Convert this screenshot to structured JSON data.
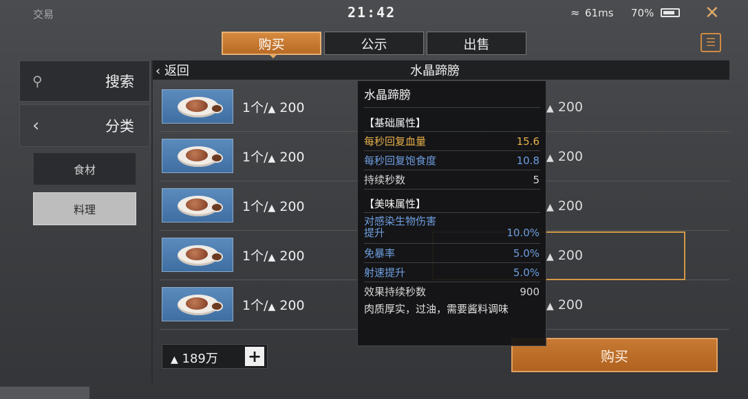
{
  "status_bar": {
    "app_name": "交易",
    "time": "21:42",
    "wifi_icon": "wifi-icon",
    "ping": "61ms",
    "battery": "70%",
    "close_icon": "close-icon"
  },
  "tabs": [
    {
      "label": "购买",
      "active": true
    },
    {
      "label": "公示",
      "active": false
    },
    {
      "label": "出售",
      "active": false
    }
  ],
  "sidebar": {
    "search": {
      "icon": "search-icon",
      "label": "搜索"
    },
    "category": {
      "icon": "chevron-left-icon",
      "label": "分类"
    },
    "subcategories": [
      {
        "label": "食材",
        "selected": false
      },
      {
        "label": "料理",
        "selected": true
      }
    ]
  },
  "header": {
    "back_label": "返回",
    "item_name": "水晶蹄膀"
  },
  "listings": [
    {
      "qty": "1个/",
      "price": "200"
    },
    {
      "qty": "1个/",
      "price": "200"
    },
    {
      "qty": "1个/",
      "price": "200"
    },
    {
      "qty": "1个/",
      "price": "200"
    },
    {
      "qty": "1个/",
      "price": "200"
    }
  ],
  "right_prices": [
    "200",
    "200",
    "200",
    "200",
    "200"
  ],
  "money": {
    "amount": "189万",
    "add_label": "+"
  },
  "buy_button": "购买",
  "tooltip": {
    "title": "水晶蹄膀",
    "basic_header": "【基础属性】",
    "basic": [
      {
        "key": "每秒回复血量",
        "value": "15.6",
        "color": "#e6b14a"
      },
      {
        "key": "每秒回复饱食度",
        "value": "10.8",
        "color": "#6e9fe0"
      },
      {
        "key": "持续秒数",
        "value": "5",
        "color": "#d6d6d6"
      }
    ],
    "flavor_header": "【美味属性】",
    "flavor": [
      {
        "key": "对感染生物伤害\n提升",
        "value": "10.0%",
        "color": "#6e9fe0"
      },
      {
        "key": "免暴率",
        "value": "5.0%",
        "color": "#6e9fe0"
      },
      {
        "key": "射速提升",
        "value": "5.0%",
        "color": "#6e9fe0"
      },
      {
        "key": "效果持续秒数",
        "value": "900",
        "color": "#d6d6d6"
      }
    ],
    "description": "肉质厚实，过油，需要酱料调味"
  },
  "colors": {
    "accent": "#d38a43",
    "highlight_gold": "#e6b14a",
    "highlight_blue": "#6e9fe0"
  }
}
